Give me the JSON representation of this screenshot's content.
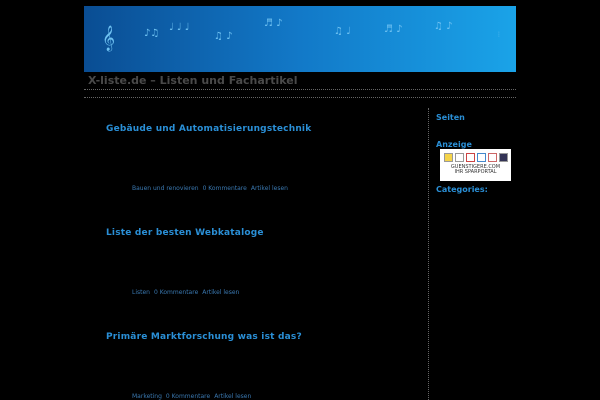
{
  "site_title": "X-liste.de – Listen und Fachartikel",
  "posts": [
    {
      "title": "Gebäude und Automatisierungstechnik",
      "category": "Bauen und renovieren",
      "comments": "0 Kommentare",
      "read": "Artikel lesen"
    },
    {
      "title": "Liste der besten Webkataloge",
      "category": "Listen",
      "comments": "0 Kommentare",
      "read": "Artikel lesen"
    },
    {
      "title": "Primäre Marktforschung was ist das?",
      "category": "Marketing",
      "comments": "0 Kommentare",
      "read": "Artikel lesen"
    }
  ],
  "sidebar": {
    "pages": "Seiten",
    "ad_heading": "Anzeige",
    "ad_line1": "GUENSTIGERE.COM",
    "ad_line2": "IHR SPARPORTAL",
    "categories": "Categories:"
  },
  "colors": {
    "accent": "#2a8fd6"
  }
}
